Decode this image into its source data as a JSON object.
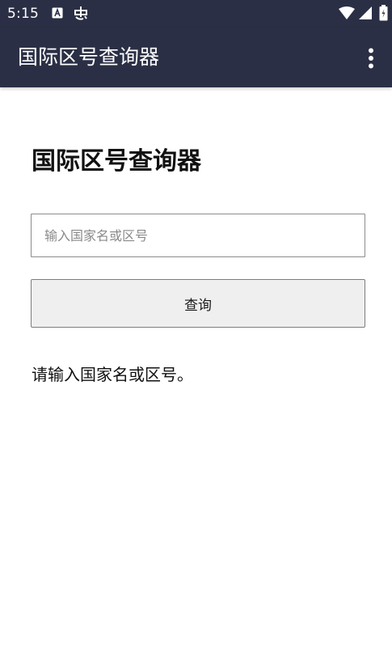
{
  "status_bar": {
    "time": "5:15",
    "icons": [
      "a-notification-icon",
      "app-notification-icon",
      "wifi-icon",
      "signal-icon",
      "battery-icon"
    ]
  },
  "app_bar": {
    "title": "国际区号查询器",
    "overflow_icon": "more-vert-icon",
    "color": "#2b2f45"
  },
  "main": {
    "heading": "国际区号查询器",
    "search": {
      "value": "",
      "placeholder": "输入国家名或区号"
    },
    "query_button_label": "查询",
    "result_message": "请输入国家名或区号。"
  }
}
